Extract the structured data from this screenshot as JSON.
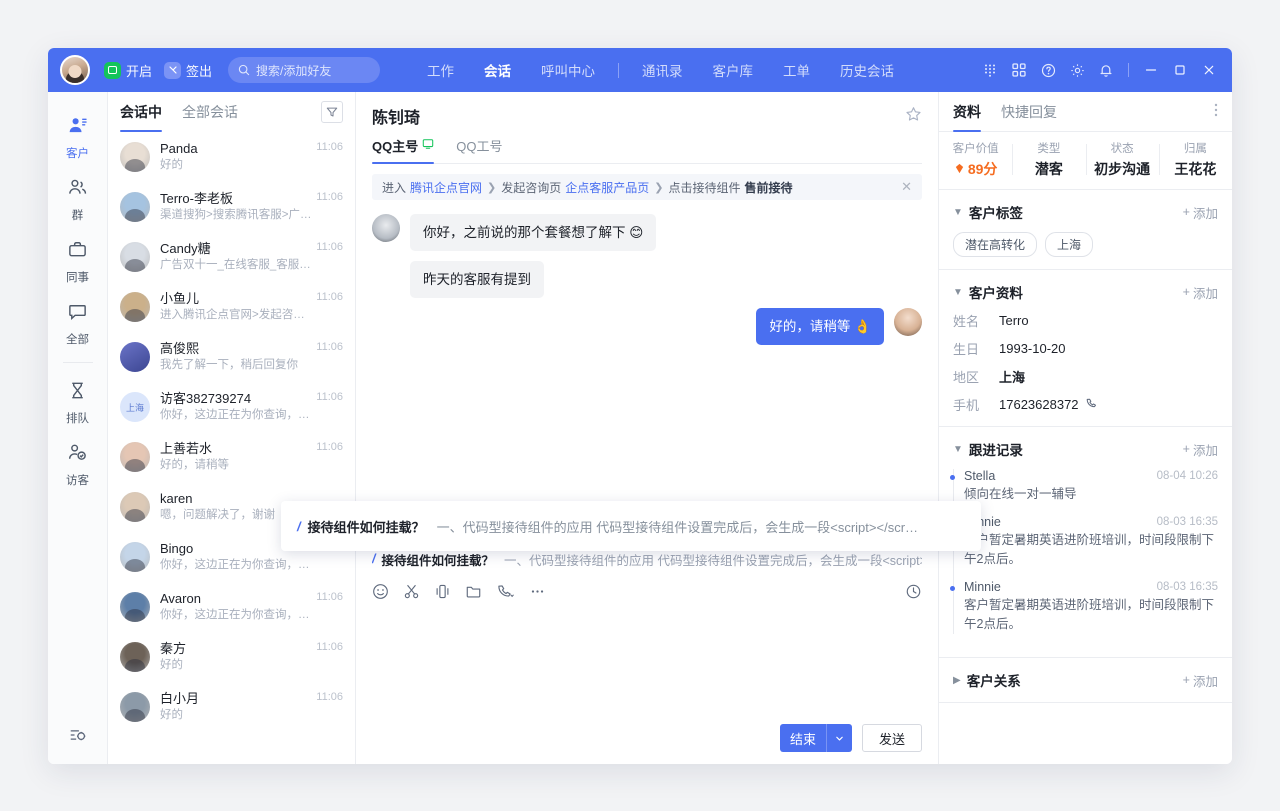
{
  "titlebar": {
    "presence_label": "开启",
    "signout_label": "签出",
    "search_placeholder": "搜索/添加好友",
    "nav": [
      {
        "label": "工作",
        "active": false
      },
      {
        "label": "会话",
        "active": true
      },
      {
        "label": "呼叫中心",
        "active": false
      },
      {
        "label": "通讯录",
        "active": false
      },
      {
        "label": "客户库",
        "active": false
      },
      {
        "label": "工单",
        "active": false
      },
      {
        "label": "历史会话",
        "active": false
      }
    ],
    "icons": [
      "dialpad-icon",
      "apps-grid-icon",
      "help-icon",
      "settings-gear-icon",
      "bell-icon",
      "minimize-icon",
      "maximize-icon",
      "close-icon"
    ]
  },
  "rail": {
    "items": [
      {
        "label": "客户",
        "icon": "customer-icon",
        "active": true
      },
      {
        "label": "群",
        "icon": "group-icon",
        "active": false
      },
      {
        "label": "同事",
        "icon": "briefcase-icon",
        "active": false
      },
      {
        "label": "全部",
        "icon": "chat-bubble-icon",
        "active": false
      },
      {
        "label": "排队",
        "icon": "hourglass-icon",
        "active": false
      },
      {
        "label": "访客",
        "icon": "visitor-icon",
        "active": false
      }
    ],
    "bottom_icon": "settings-sliders-icon"
  },
  "conversation_list": {
    "tabs": [
      {
        "label": "会话中",
        "active": true
      },
      {
        "label": "全部会话",
        "active": false
      }
    ],
    "filter_icon": "filter-icon",
    "items": [
      {
        "name": "Panda",
        "preview": "好的",
        "time": "11:06",
        "avatar_kind": "photo",
        "avatar_color": "#e8ded4"
      },
      {
        "name": "Terro-李老板",
        "preview": "渠道搜狗>搜索腾讯客服>广告双十一_在线",
        "time": "11:06",
        "avatar_kind": "photo",
        "avatar_color": "#a5c3e0"
      },
      {
        "name": "Candy糖",
        "preview": "广告双十一_在线客服_客服机器人>进入腾",
        "time": "11:06",
        "avatar_kind": "photo",
        "avatar_color": "#d8dde4"
      },
      {
        "name": "小鱼儿",
        "preview": "进入腾讯企点官网>发起咨询页企点客服产",
        "time": "11:06",
        "avatar_kind": "photo",
        "avatar_color": "#cbb08a"
      },
      {
        "name": "高俊熙",
        "preview": "我先了解一下，稍后回复你",
        "time": "11:06",
        "avatar_kind": "gradient",
        "avatar_color": "#5a64b8"
      },
      {
        "name": "访客382739274",
        "preview": "你好，这边正在为你查询，请稍等",
        "time": "11:06",
        "avatar_kind": "text",
        "avatar_text": "上海",
        "avatar_color": "#dbe6fb"
      },
      {
        "name": "上善若水",
        "preview": "好的，请稍等",
        "time": "11:06",
        "avatar_kind": "photo",
        "avatar_color": "#e5c6b4"
      },
      {
        "name": "karen",
        "preview": "嗯，问题解决了，谢谢",
        "time": "",
        "avatar_kind": "photo",
        "avatar_color": "#dcc9b6"
      },
      {
        "name": "Bingo",
        "preview": "你好，这边正在为你查询，请稍等",
        "time": "11:06",
        "avatar_kind": "photo",
        "avatar_color": "#c4d5e8"
      },
      {
        "name": "Avaron",
        "preview": "你好，这边正在为你查询，请稍等",
        "time": "11:06",
        "avatar_kind": "photo",
        "avatar_color": "#5d7fa8"
      },
      {
        "name": "秦方",
        "preview": "好的",
        "time": "11:06",
        "avatar_kind": "photo",
        "avatar_color": "#6d6258"
      },
      {
        "name": "白小月",
        "preview": "好的",
        "time": "11:06",
        "avatar_kind": "photo",
        "avatar_color": "#8c9aa8"
      }
    ]
  },
  "chat": {
    "title": "陈钊琦",
    "star_icon": "star-outline-icon",
    "tabs": [
      {
        "label": "QQ主号",
        "active": true,
        "icon": "monitor-online-icon"
      },
      {
        "label": "QQ工号",
        "active": false,
        "icon": ""
      }
    ],
    "breadcrumb": {
      "prefix": "进入",
      "link1": "腾讯企点官网",
      "mid1": "发起咨询页",
      "link2": "企点客服产品页",
      "mid2": "点击接待组件",
      "bold": "售前接待",
      "close_icon": "close-icon"
    },
    "messages": [
      {
        "side": "them",
        "text": "你好，之前说的那个套餐想了解下 😊"
      },
      {
        "side": "them",
        "text": "昨天的客服有提到"
      },
      {
        "side": "me",
        "text": "好的，请稍等 👌"
      }
    ],
    "popup": {
      "marker": "/",
      "question": "接待组件如何挂载？",
      "answer": "一、代码型接待组件的应用 代码型接待组件设置完成后，会生成一段<script></scr…"
    },
    "suggestion": {
      "marker": "/",
      "question": "接待组件如何挂载？",
      "answer": "一、代码型接待组件的应用 代码型接待组件设置完成后，会生成一段<script></scr…"
    },
    "tools": [
      "emoji-icon",
      "screenshot-scissors-icon",
      "shake-icon",
      "folder-icon",
      "phone-call-icon",
      "more-ellipsis-icon"
    ],
    "history_icon": "history-clock-icon",
    "end_label": "结束",
    "end_dropdown_icon": "chevron-down-icon",
    "send_label": "发送"
  },
  "panel": {
    "tabs": [
      {
        "label": "资料",
        "active": true
      },
      {
        "label": "快捷回复",
        "active": false
      }
    ],
    "more_icon": "more-vertical-icon",
    "stats": [
      {
        "key": "客户价值",
        "value": "89分",
        "icon": "diamond-icon",
        "accent": true
      },
      {
        "key": "类型",
        "value": "潜客",
        "icon": "",
        "accent": false
      },
      {
        "key": "状态",
        "value": "初步沟通",
        "icon": "",
        "accent": false
      },
      {
        "key": "归属",
        "value": "王花花",
        "icon": "",
        "accent": false
      }
    ],
    "sections": {
      "tags": {
        "title": "客户标签",
        "add_label": "添加",
        "expanded": true,
        "items": [
          "潜在高转化",
          "上海"
        ]
      },
      "profile": {
        "title": "客户资料",
        "add_label": "添加",
        "expanded": true,
        "fields": [
          {
            "key": "姓名",
            "value": "Terro",
            "bold": false,
            "icon": ""
          },
          {
            "key": "生日",
            "value": "1993-10-20",
            "bold": false,
            "icon": ""
          },
          {
            "key": "地区",
            "value": "上海",
            "bold": true,
            "icon": ""
          },
          {
            "key": "手机",
            "value": "17623628372",
            "bold": false,
            "icon": "phone-icon"
          }
        ]
      },
      "follow": {
        "title": "跟进记录",
        "add_label": "添加",
        "expanded": true,
        "records": [
          {
            "name": "Stella",
            "date": "08-04",
            "time": "10:26",
            "text": "倾向在线一对一辅导"
          },
          {
            "name": "Minnie",
            "date": "08-03",
            "time": "16:35",
            "text": "客户暂定暑期英语进阶班培训，时间段限制下午2点后。"
          },
          {
            "name": "Minnie",
            "date": "08-03",
            "time": "16:35",
            "text": "客户暂定暑期英语进阶班培训，时间段限制下午2点后。"
          }
        ]
      },
      "relations": {
        "title": "客户关系",
        "add_label": "添加",
        "expanded": false
      }
    }
  },
  "colors": {
    "brand": "#4a6ff0",
    "accent_orange": "#f56c20",
    "online_green": "#14c45a"
  }
}
